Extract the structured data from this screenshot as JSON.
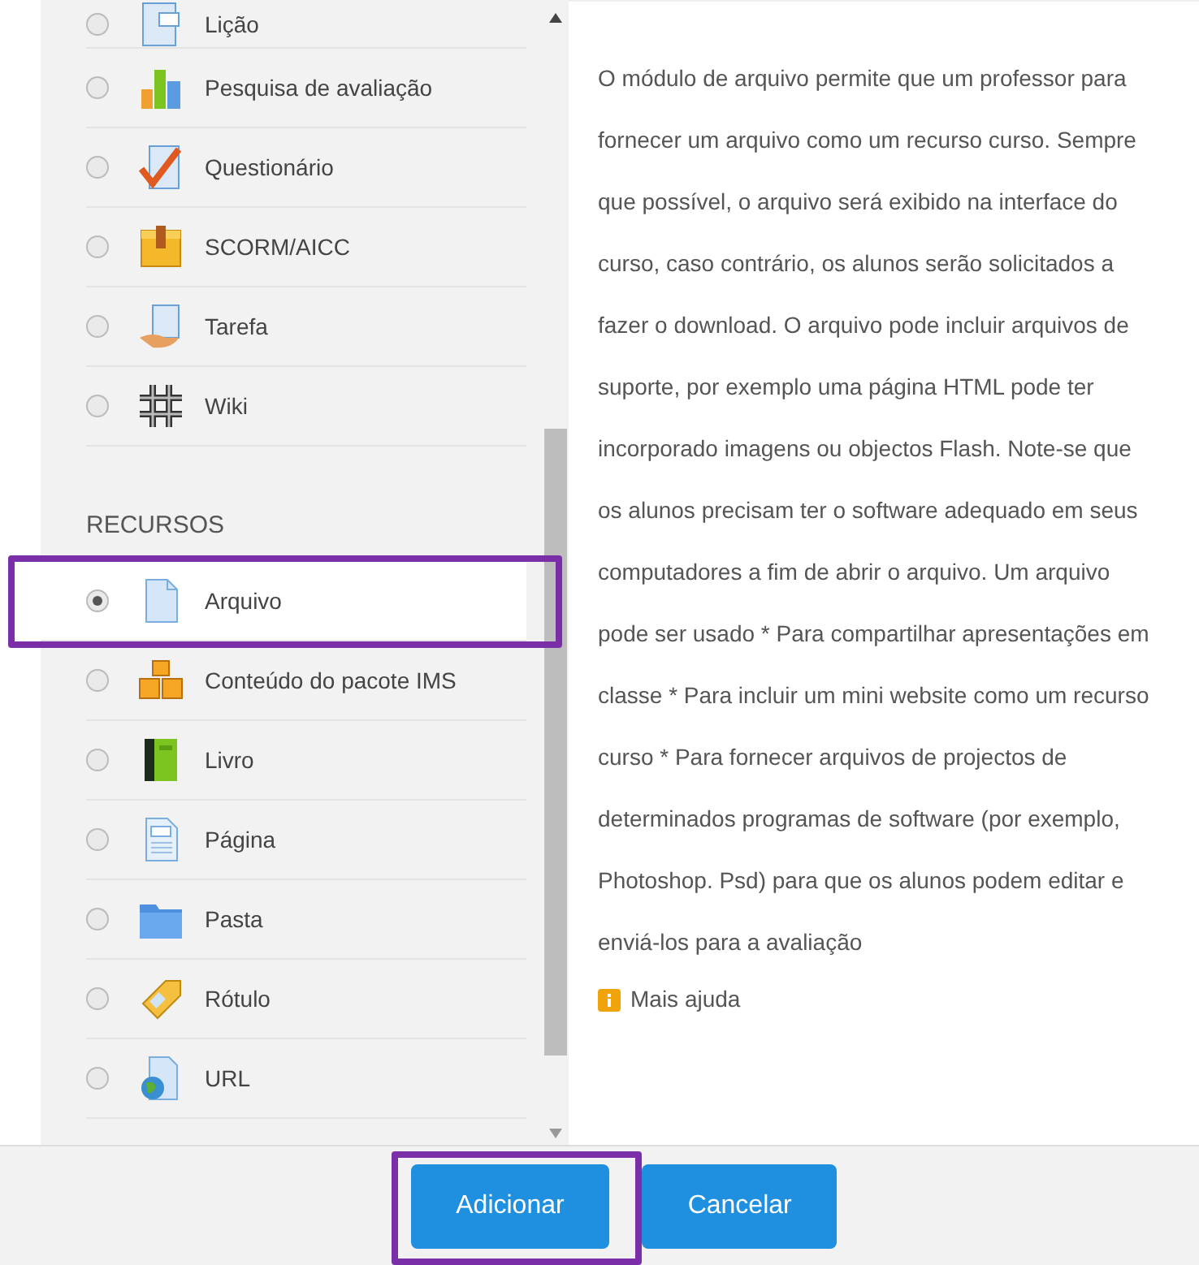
{
  "activities": {
    "items": [
      {
        "label": "Lição",
        "selected": false,
        "highlighted": false
      },
      {
        "label": "Pesquisa de avaliação",
        "selected": false,
        "highlighted": false
      },
      {
        "label": "Questionário",
        "selected": false,
        "highlighted": false
      },
      {
        "label": "SCORM/AICC",
        "selected": false,
        "highlighted": false
      },
      {
        "label": "Tarefa",
        "selected": false,
        "highlighted": false
      },
      {
        "label": "Wiki",
        "selected": false,
        "highlighted": false
      }
    ]
  },
  "resources": {
    "heading": "RECURSOS",
    "items": [
      {
        "label": "Arquivo",
        "selected": true,
        "highlighted": true
      },
      {
        "label": "Conteúdo do pacote IMS",
        "selected": false,
        "highlighted": false
      },
      {
        "label": "Livro",
        "selected": false,
        "highlighted": false
      },
      {
        "label": "Página",
        "selected": false,
        "highlighted": false
      },
      {
        "label": "Pasta",
        "selected": false,
        "highlighted": false
      },
      {
        "label": "Rótulo",
        "selected": false,
        "highlighted": false
      },
      {
        "label": "URL",
        "selected": false,
        "highlighted": false
      }
    ]
  },
  "help": {
    "text": "O módulo de arquivo permite que um professor para fornecer um arquivo como um recurso curso. Sempre que possível, o arquivo será exibido na interface do curso, caso contrário, os alunos serão solicitados a fazer o download. O arquivo pode incluir arquivos de suporte, por exemplo uma página HTML pode ter incorporado imagens ou objectos Flash. Note-se que os alunos precisam ter o software adequado em seus computadores a fim de abrir o arquivo. Um arquivo pode ser usado * Para compartilhar apresentações em classe * Para incluir um mini website como um recurso curso * Para fornecer arquivos de projectos de determinados programas de software (por exemplo, Photoshop. Psd) para que os alunos podem editar e enviá-los para a avaliação",
    "link": "Mais ajuda"
  },
  "buttons": [
    {
      "label": "Adicionar",
      "highlighted": true
    },
    {
      "label": "Cancelar"
    }
  ]
}
